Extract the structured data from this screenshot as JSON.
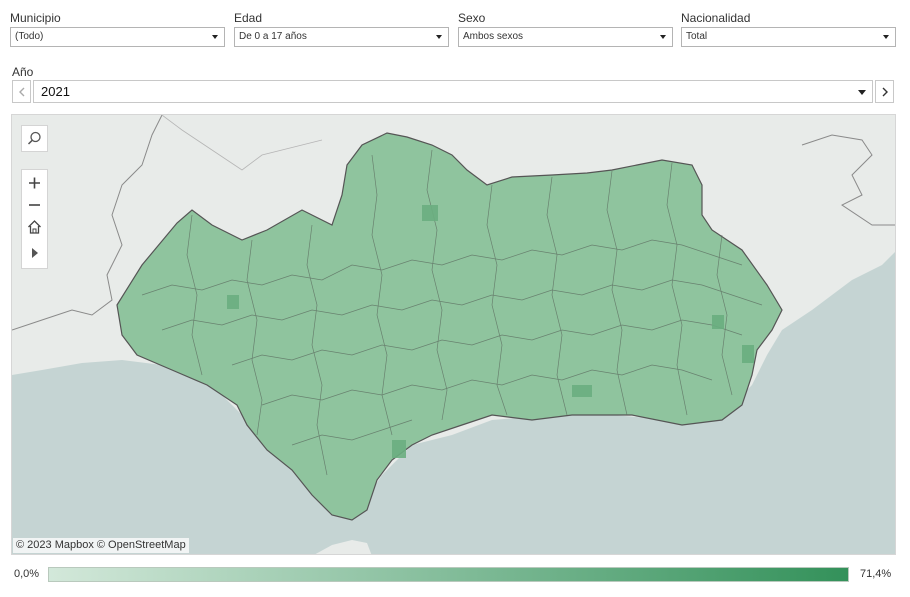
{
  "filters": {
    "municipio": {
      "label": "Municipio",
      "value": "(Todo)"
    },
    "edad": {
      "label": "Edad",
      "value": "De 0 a 17 años"
    },
    "sexo": {
      "label": "Sexo",
      "value": "Ambos sexos"
    },
    "nacionalidad": {
      "label": "Nacionalidad",
      "value": "Total"
    }
  },
  "year": {
    "label": "Año",
    "value": "2021"
  },
  "map": {
    "attribution": "© 2023 Mapbox  © OpenStreetMap",
    "land_color": "#e8ebe9",
    "sea_color": "#c5d4d3",
    "region_color": "#8fc49e",
    "border_color": "#555555"
  },
  "legend": {
    "min_label": "0,0%",
    "max_label": "71,4%",
    "color_min": "#d3e8da",
    "color_max": "#33915a"
  },
  "icons": [
    "search-icon",
    "zoom-in-icon",
    "zoom-out-icon",
    "home-icon",
    "play-icon",
    "chevron-left-icon",
    "chevron-right-icon"
  ]
}
